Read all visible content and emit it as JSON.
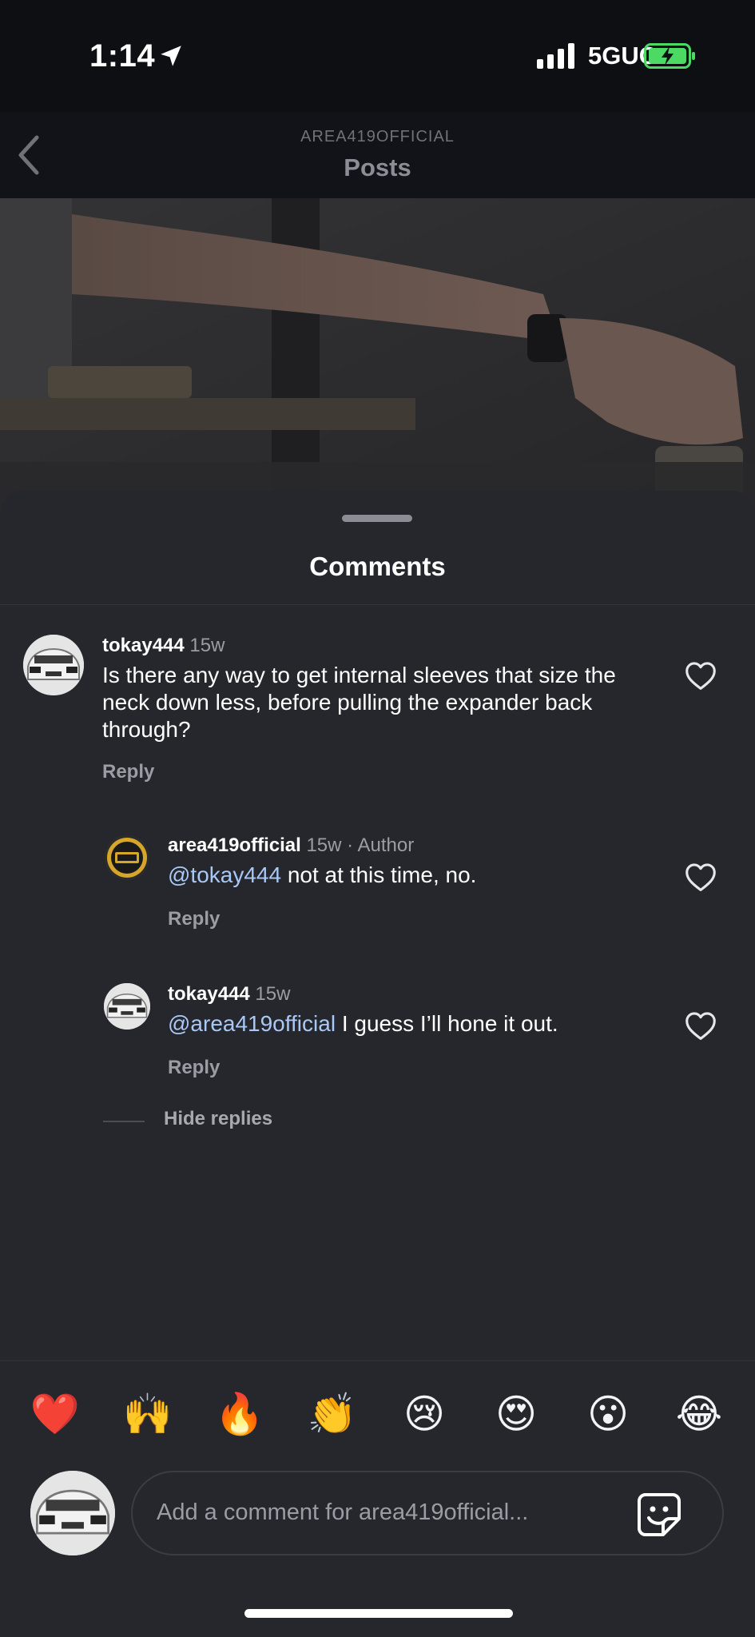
{
  "status": {
    "time": "1:14",
    "network": "5GUC"
  },
  "header": {
    "account": "AREA419OFFICIAL",
    "title": "Posts"
  },
  "sheet": {
    "title": "Comments"
  },
  "comments": [
    {
      "user": "tokay444",
      "time": "15w",
      "text": "Is there any way to get internal sleeves that size the neck down less, before pulling the expander back through?",
      "reply": "Reply"
    }
  ],
  "replies": [
    {
      "user": "area419official",
      "time": "15w",
      "badge": "· Author",
      "mention": "@tokay444",
      "text": " not at this time, no.",
      "reply": "Reply"
    },
    {
      "user": "tokay444",
      "time": "15w",
      "badge": "",
      "mention": "@area419official",
      "text": " I guess I’ll hone it out.",
      "reply": "Reply"
    }
  ],
  "hide_replies": "Hide replies",
  "emojis": [
    "❤️",
    "🙌",
    "🔥",
    "👏",
    "😢",
    "😍",
    "😮",
    "😂"
  ],
  "composer": {
    "placeholder": "Add a comment for area419official..."
  },
  "icons": {
    "back": "chevron-left-icon",
    "heart": "heart-outline-icon",
    "sticker": "sticker-icon",
    "location": "location-arrow-icon"
  },
  "colors": {
    "sheet": "#25272d",
    "mention": "#a9c8f5",
    "battery": "#4cd964"
  }
}
